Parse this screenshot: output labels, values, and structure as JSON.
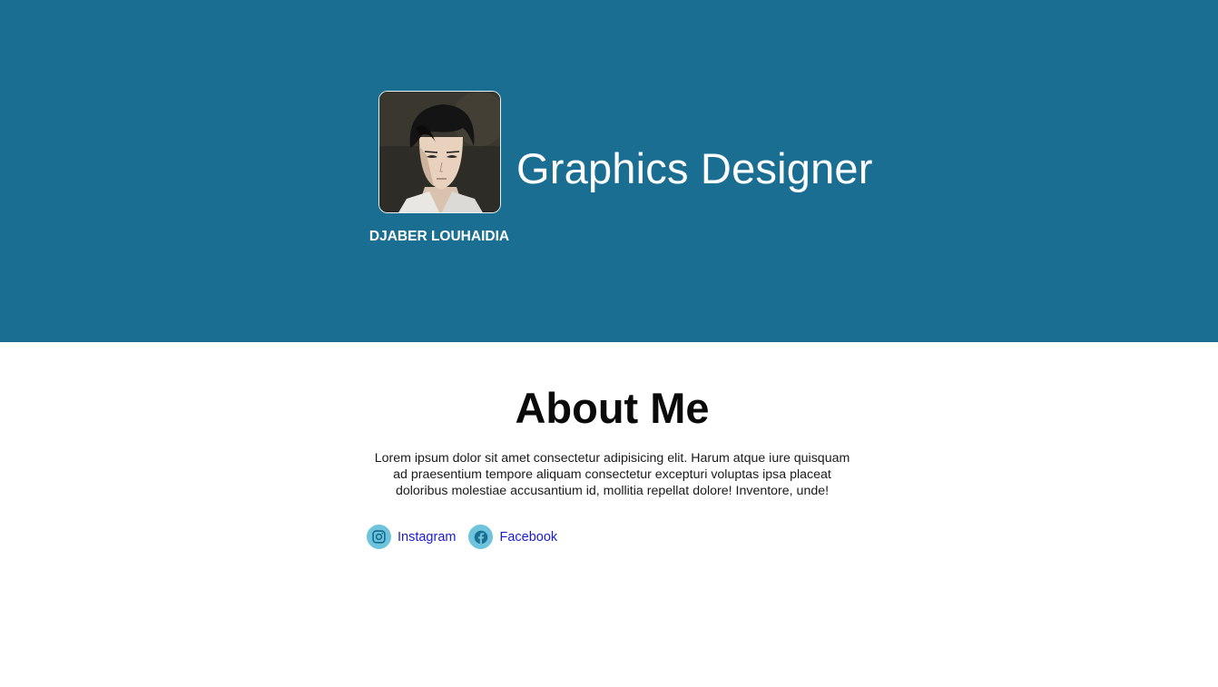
{
  "header": {
    "avatar_alt": "profile picture",
    "name": "DJABER LOUHAIDIA",
    "job_title": "Graphics Designer",
    "background_color": "#196e92"
  },
  "about": {
    "title": "About Me",
    "text": "Lorem ipsum dolor sit amet consectetur adipisicing elit. Harum atque iure quisquam ad praesentium tempore aliquam consectetur excepturi voluptas ipsa placeat doloribus molestiae accusantium id, mollitia repellat dolore! Inventore, unde!"
  },
  "socials": [
    {
      "label": "Instagram",
      "icon": "instagram-icon"
    },
    {
      "label": "Facebook",
      "icon": "facebook-icon"
    }
  ],
  "colors": {
    "link": "#1a1ad6",
    "icon_bg": "#6ec3dd",
    "icon_fg": "#196e92"
  }
}
